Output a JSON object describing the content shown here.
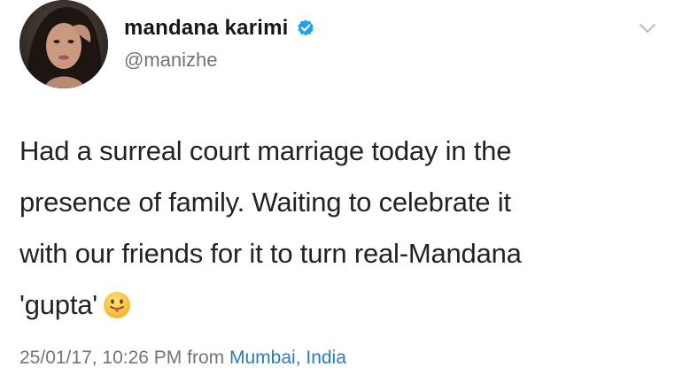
{
  "author": {
    "display_name": "mandana karimi",
    "handle": "@manizhe",
    "verified": true
  },
  "tweet": {
    "line1": "Had a surreal court marriage today in the",
    "line2": "presence of family. Waiting to celebrate it",
    "line3": "with our friends for it to turn real-Mandana",
    "line4": "'gupta'",
    "emoji": "face-with-tongue"
  },
  "meta": {
    "timestamp": "25/01/17, 10:26 PM",
    "from_label": "from",
    "location": "Mumbai, India"
  },
  "colors": {
    "verified_blue": "#1da1f2",
    "link_blue": "#2b7bb9",
    "muted_grey": "#6e767d"
  },
  "icons": {
    "menu": "chevron-down-icon",
    "verified": "verified-badge-icon",
    "emoji": "tongue-out-emoji-icon"
  }
}
